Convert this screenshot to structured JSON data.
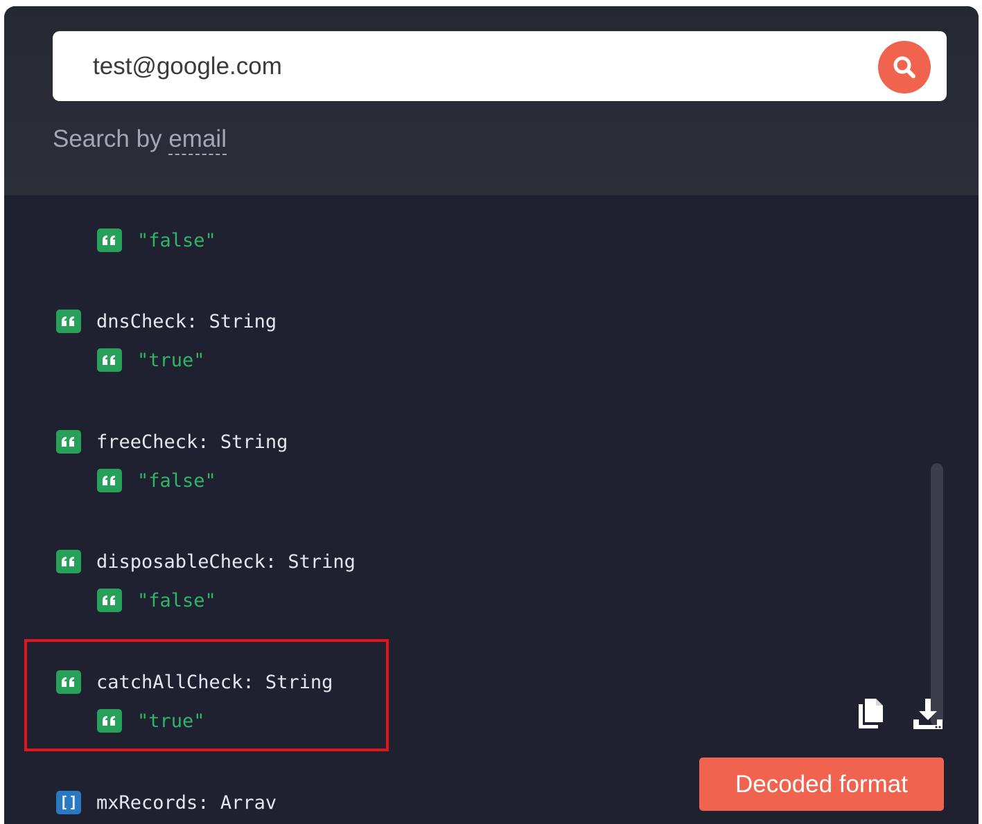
{
  "search": {
    "value": "test@google.com",
    "hint_prefix": "Search by",
    "hint_word": "email"
  },
  "tree": {
    "orphan_value": "\"false\"",
    "fields": [
      {
        "name": "dnsCheck:",
        "type": "String",
        "value": "\"true\""
      },
      {
        "name": "freeCheck:",
        "type": "String",
        "value": "\"false\""
      },
      {
        "name": "disposableCheck:",
        "type": "String",
        "value": "\"false\""
      },
      {
        "name": "catchAllCheck:",
        "type": "String",
        "value": "\"true\""
      }
    ],
    "array_field": {
      "name": "mxRecords:",
      "type": "Arrav",
      "icon_text": "[]"
    }
  },
  "actions": {
    "decoded_label": "Decoded format"
  },
  "icons": {
    "search": "search-icon",
    "quote": "quote-icon",
    "array": "array-icon",
    "copy": "copy-icon",
    "download": "download-icon"
  },
  "colors": {
    "panel": "#1f2130",
    "accent": "#f0634f",
    "string_value": "#2fb56a",
    "quote_icon": "#27a05a",
    "array_icon": "#2b78c2",
    "highlight": "#e2141c"
  }
}
